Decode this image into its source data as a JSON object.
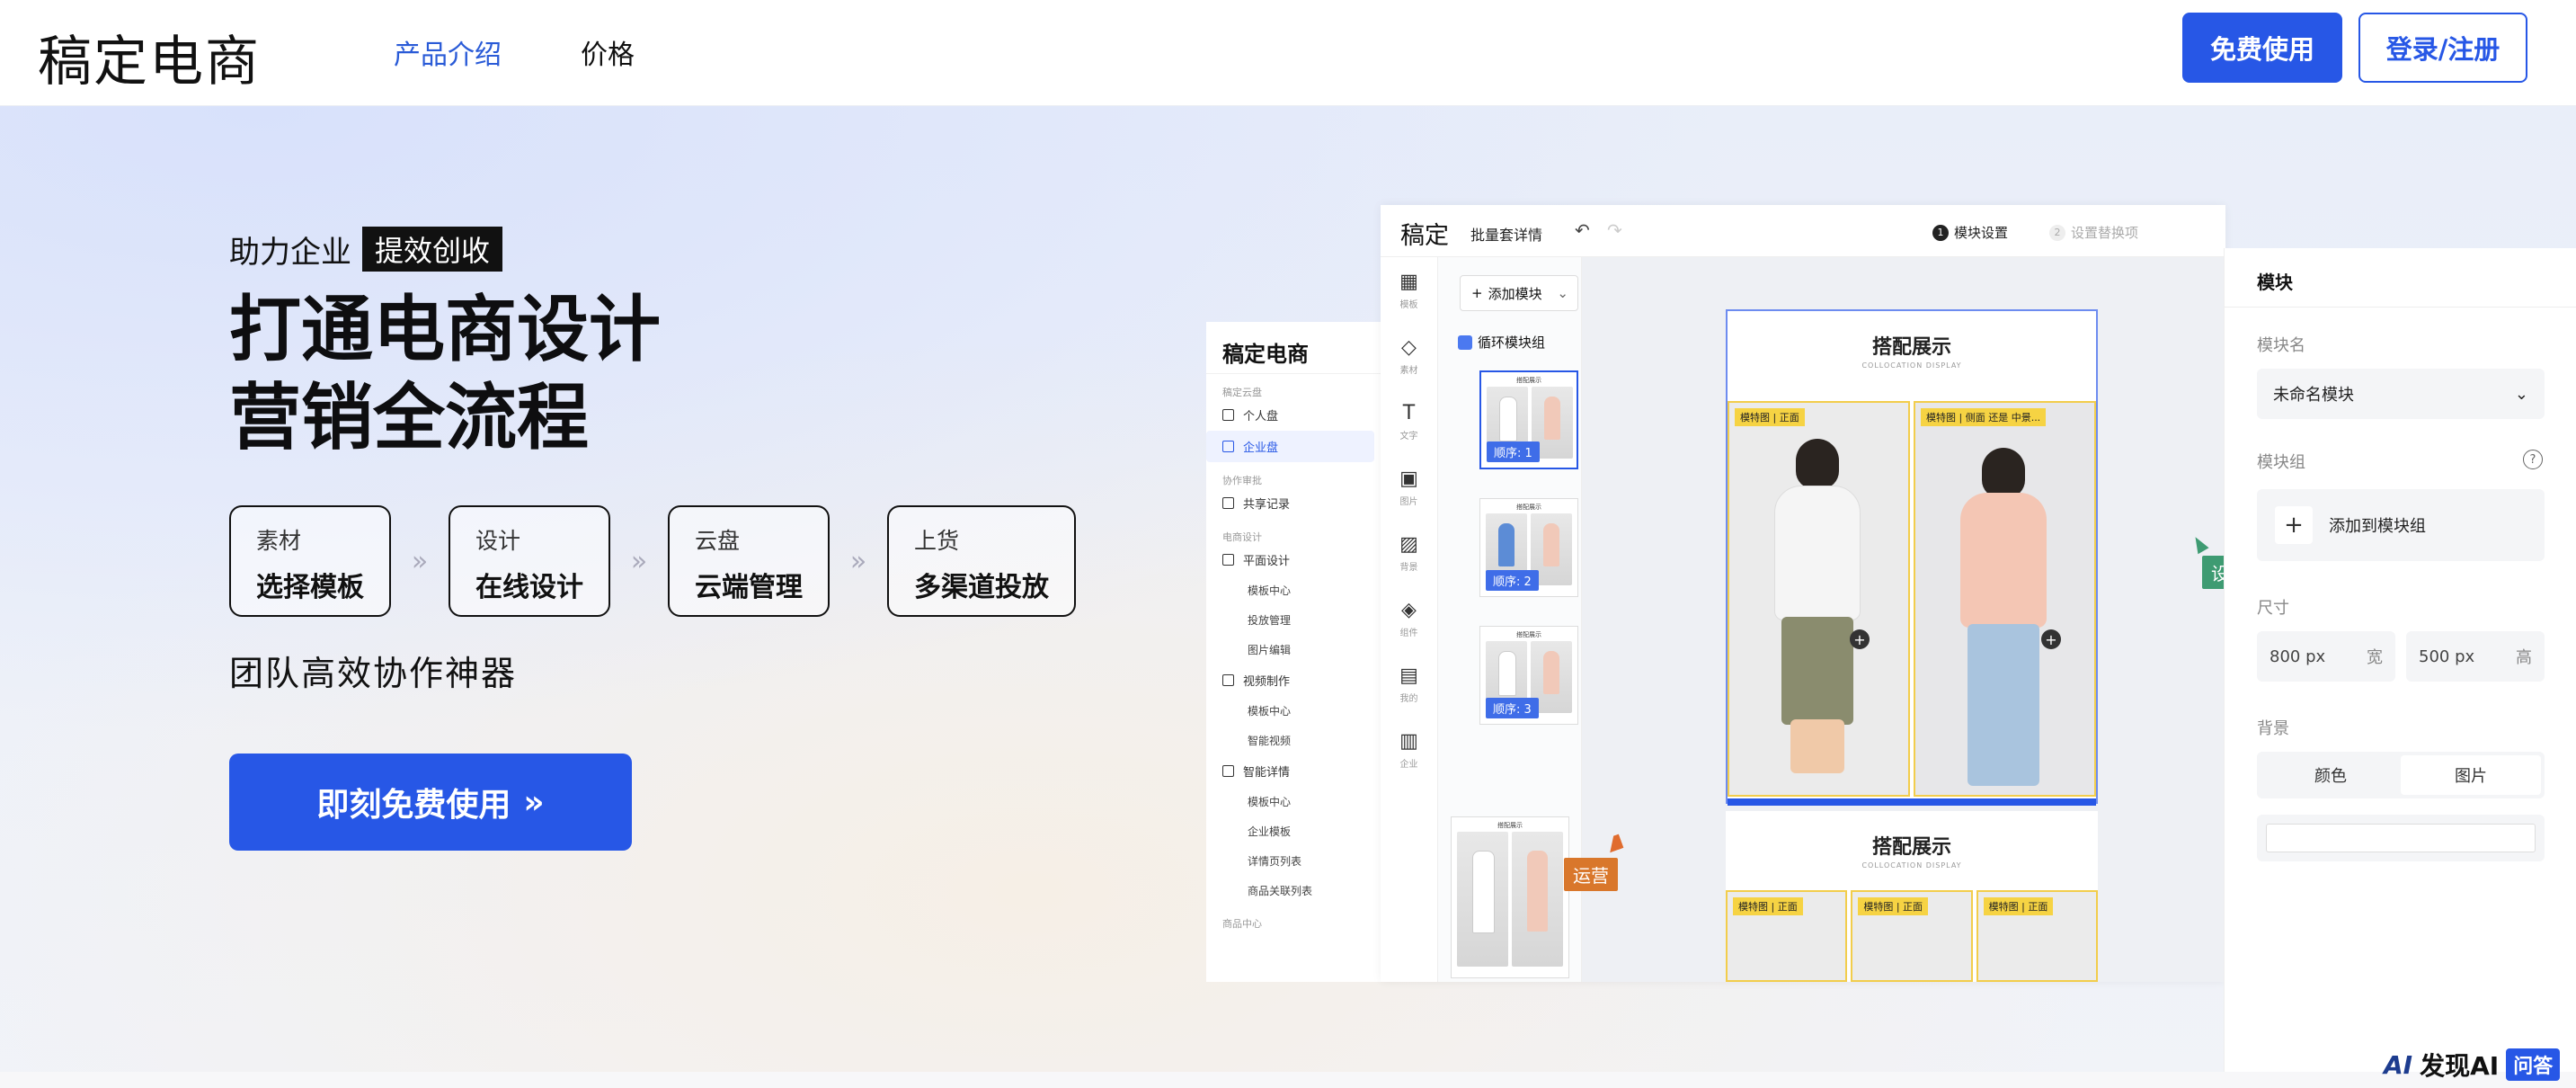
{
  "header": {
    "logo": "稿定电商",
    "nav": [
      "产品介绍",
      "价格"
    ],
    "free_button": "免费使用",
    "login_button": "登录/注册"
  },
  "hero": {
    "tagline_prefix": "助力企业",
    "tagline_highlight": "提效创收",
    "headline_line1": "打通电商设计",
    "headline_line2": "营销全流程",
    "steps": [
      {
        "small": "素材",
        "big": "选择模板"
      },
      {
        "small": "设计",
        "big": "在线设计"
      },
      {
        "small": "云盘",
        "big": "云端管理"
      },
      {
        "small": "上货",
        "big": "多渠道投放"
      }
    ],
    "step_arrow": "»",
    "team_text": "团队高效协作神器",
    "cta_label": "即刻免费使用",
    "cta_arrow": "»"
  },
  "sidebar_panel": {
    "title": "稿定电商",
    "group1": "稿定云盘",
    "personal": "个人盘",
    "enterprise": "企业盘",
    "group2": "协作审批",
    "shared": "共享记录",
    "group3": "电商设计",
    "flat_design": "平面设计",
    "flat_subs": [
      "模板中心",
      "投放管理",
      "图片编辑"
    ],
    "video": "视频制作",
    "video_subs": [
      "模板中心",
      "智能视频"
    ],
    "detail": "智能详情",
    "detail_subs": [
      "模板中心",
      "企业模板",
      "详情页列表",
      "商品关联列表"
    ],
    "group4": "商品中心"
  },
  "editor": {
    "logo": "稿定",
    "doc_name": "批量套详情",
    "undo_icon": "↶",
    "redo_icon": "↷",
    "step1_num": "1",
    "step1": "模块设置",
    "step2_num": "2",
    "step2": "设置替换项",
    "toolbar": [
      {
        "icon": "layout-icon",
        "glyph": "▦",
        "label": "模板"
      },
      {
        "icon": "shapes-icon",
        "glyph": "◇",
        "label": "素材"
      },
      {
        "icon": "text-icon",
        "glyph": "T",
        "label": "文字"
      },
      {
        "icon": "image-icon",
        "glyph": "▣",
        "label": "图片"
      },
      {
        "icon": "background-icon",
        "glyph": "▨",
        "label": "背景"
      },
      {
        "icon": "component-icon",
        "glyph": "◈",
        "label": "组件"
      },
      {
        "icon": "mine-icon",
        "glyph": "▤",
        "label": "我的"
      },
      {
        "icon": "enterprise-icon",
        "glyph": "▥",
        "label": "企业"
      }
    ],
    "add_module": "添加模块",
    "add_module_plus": "+",
    "add_module_chevron": "⌄",
    "loop_group": "循环模块组",
    "thumb_title": "搭配展示",
    "orders": [
      "顺序: 1",
      "顺序: 2",
      "顺序: 3"
    ],
    "design_title": "搭配展示",
    "design_sub": "COLLOCATION DISPLAY",
    "photo_labels": [
      "模特图 | 正面",
      "模特图 | 侧面 还是 中景..."
    ],
    "photo_plus": "+",
    "design2_title": "搭配展示",
    "design2_sub": "COLLOCATION DISPLAY",
    "photo2_labels": [
      "模特图 | 正面",
      "模特图 | 正面",
      "模特图 | 正面"
    ]
  },
  "collab": {
    "operator": "运营",
    "designer": "设计师"
  },
  "props": {
    "title": "模块",
    "name_label": "模块名",
    "name_value": "未命名模块",
    "chevron": "⌄",
    "group_label": "模块组",
    "help_icon": "?",
    "add_group_plus": "+",
    "add_group": "添加到模块组",
    "size_label": "尺寸",
    "width_value": "800 px",
    "width_unit": "宽",
    "height_value": "500 px",
    "height_unit": "高",
    "bg_label": "背景",
    "bg_color": "颜色",
    "bg_image": "图片"
  },
  "watermark": {
    "logo": "AI",
    "text": "发现AI",
    "badge": "问答"
  },
  "colors": {
    "accent": "#2757e6",
    "operator": "#d9772b",
    "designer": "#3e9b72",
    "label_yellow": "#f6d343"
  }
}
